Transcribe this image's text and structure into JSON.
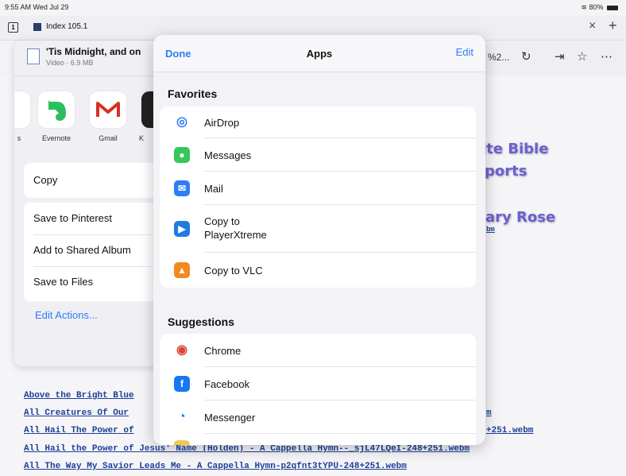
{
  "status_bar": {
    "time": "9:55 AM  Wed Jul 29",
    "battery": "80%"
  },
  "tab_bar": {
    "tab_count": "1",
    "tab_title": "Index 105.1"
  },
  "toolbar": {
    "url_fragment": "%2..."
  },
  "web_page": {
    "purple_text": [
      "ite Bible",
      "ports",
      "ary Rose"
    ],
    "purple_small": "bm",
    "link_fragments": [
      {
        "text": "Above the Bright Blue",
        "right": ""
      },
      {
        "text": "All Creatures Of Our",
        "right": "m"
      },
      {
        "text": "All Hail The Power of",
        "right": "+251.webm"
      }
    ],
    "links_full": [
      "All Hail the Power of Jesus' Name (Holden) - A Cappella Hymn--_sjL47LQeI-248+251.webm",
      "All The Way My Savior Leads Me - A Cappella Hymn-p2qfnt3tYPU-248+251.webm"
    ]
  },
  "share_sheet": {
    "file_name": "'Tis Midnight, and on",
    "file_info": "Video · 6.9 MB",
    "apps": [
      {
        "label": "s"
      },
      {
        "label": "Evernote"
      },
      {
        "label": "Gmail"
      },
      {
        "label": "K"
      }
    ],
    "copy_label": "Copy",
    "actions": [
      "Save to Pinterest",
      "Add to Shared Album",
      "Save to Files"
    ],
    "edit_actions_label": "Edit Actions..."
  },
  "apps_modal": {
    "done_label": "Done",
    "title": "Apps",
    "edit_label": "Edit",
    "favorites_title": "Favorites",
    "favorites": [
      {
        "label": "AirDrop",
        "icon": "airdrop-icon",
        "color": "#ffffff"
      },
      {
        "label": "Messages",
        "icon": "messages-icon",
        "color": "#34c759"
      },
      {
        "label": "Mail",
        "icon": "mail-icon",
        "color": "#2f7cf6"
      },
      {
        "label": "Copy to\nPlayerXtreme",
        "icon": "playerxtreme-icon",
        "color": "#1e7be0"
      },
      {
        "label": "Copy to VLC",
        "icon": "vlc-icon",
        "color": "#f28a1d"
      }
    ],
    "suggestions_title": "Suggestions",
    "suggestions": [
      {
        "label": "Chrome",
        "icon": "chrome-icon",
        "color": "#ffffff"
      },
      {
        "label": "Facebook",
        "icon": "facebook-icon",
        "color": "#1877f2"
      },
      {
        "label": "Messenger",
        "icon": "messenger-icon",
        "color": "#ffffff"
      }
    ]
  }
}
